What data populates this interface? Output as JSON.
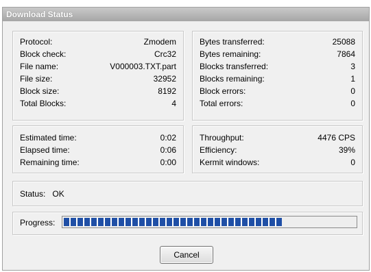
{
  "window": {
    "title": "Download Status"
  },
  "transfer_info": [
    {
      "label": "Protocol:",
      "value": "Zmodem"
    },
    {
      "label": "Block check:",
      "value": "Crc32"
    },
    {
      "label": "File name:",
      "value": "V000003.TXT.part"
    },
    {
      "label": "File size:",
      "value": "32952"
    },
    {
      "label": "Block size:",
      "value": "8192"
    },
    {
      "label": "Total Blocks:",
      "value": "4"
    }
  ],
  "transfer_counts": [
    {
      "label": "Bytes transferred:",
      "value": "25088"
    },
    {
      "label": "Bytes remaining:",
      "value": "7864"
    },
    {
      "label": "Blocks transferred:",
      "value": "3"
    },
    {
      "label": "Blocks remaining:",
      "value": "1"
    },
    {
      "label": "Block errors:",
      "value": "0"
    },
    {
      "label": "Total errors:",
      "value": "0"
    }
  ],
  "timing": [
    {
      "label": "Estimated time:",
      "value": "0:02"
    },
    {
      "label": "Elapsed time:",
      "value": "0:06"
    },
    {
      "label": "Remaining time:",
      "value": "0:00"
    }
  ],
  "performance": [
    {
      "label": "Throughput:",
      "value": "4476 CPS"
    },
    {
      "label": "Efficiency:",
      "value": "39%"
    },
    {
      "label": "Kermit windows:",
      "value": "0"
    }
  ],
  "status": {
    "label": "Status:",
    "value": "OK"
  },
  "progress": {
    "label": "Progress:",
    "fraction": 0.76
  },
  "buttons": {
    "cancel": "Cancel"
  },
  "colors": {
    "progress_fill": "#1f4fa6",
    "title_bar": "#b5b5b5"
  }
}
